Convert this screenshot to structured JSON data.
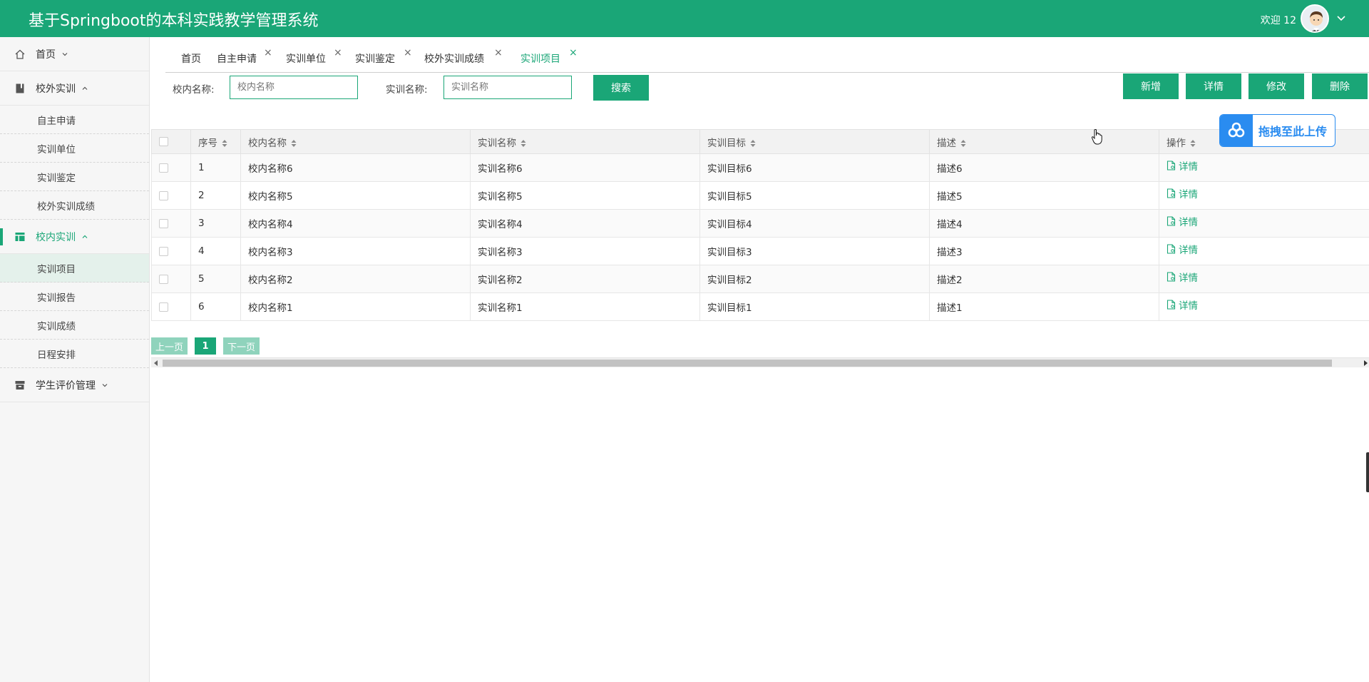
{
  "header": {
    "title": "基于Springboot的本科实践教学管理系统",
    "welcome": "欢迎 12"
  },
  "sidebar": {
    "home": "首页",
    "group_external": "校外实训",
    "external_items": [
      "自主申请",
      "实训单位",
      "实训鉴定",
      "校外实训成绩"
    ],
    "group_internal": "校内实训",
    "internal_items": [
      "实训项目",
      "实训报告",
      "实训成绩",
      "日程安排"
    ],
    "group_eval": "学生评价管理"
  },
  "tabs": [
    {
      "label": "首页",
      "closable": false
    },
    {
      "label": "自主申请",
      "closable": true
    },
    {
      "label": "实训单位",
      "closable": true
    },
    {
      "label": "实训鉴定",
      "closable": true
    },
    {
      "label": "校外实训成绩",
      "closable": true
    },
    {
      "label": "实训项目",
      "closable": true,
      "active": true
    }
  ],
  "tab_close_glyph": "×",
  "filters": {
    "school_name_label": "校内名称:",
    "school_name_placeholder": "校内名称",
    "training_name_label": "实训名称:",
    "training_name_placeholder": "实训名称",
    "search_button": "搜索"
  },
  "actions": {
    "add": "新增",
    "detail": "详情",
    "edit": "修改",
    "delete": "删除"
  },
  "upload_widget": {
    "label": "拖拽至此上传"
  },
  "table": {
    "columns": [
      "序号",
      "校内名称",
      "实训名称",
      "实训目标",
      "描述",
      "操作"
    ],
    "rows": [
      {
        "no": "1",
        "school": "校内名称6",
        "name": "实训名称6",
        "goal": "实训目标6",
        "desc": "描述6",
        "op": "详情"
      },
      {
        "no": "2",
        "school": "校内名称5",
        "name": "实训名称5",
        "goal": "实训目标5",
        "desc": "描述5",
        "op": "详情"
      },
      {
        "no": "3",
        "school": "校内名称4",
        "name": "实训名称4",
        "goal": "实训目标4",
        "desc": "描述4",
        "op": "详情"
      },
      {
        "no": "4",
        "school": "校内名称3",
        "name": "实训名称3",
        "goal": "实训目标3",
        "desc": "描述3",
        "op": "详情"
      },
      {
        "no": "5",
        "school": "校内名称2",
        "name": "实训名称2",
        "goal": "实训目标2",
        "desc": "描述2",
        "op": "详情"
      },
      {
        "no": "6",
        "school": "校内名称1",
        "name": "实训名称1",
        "goal": "实训目标1",
        "desc": "描述1",
        "op": "详情"
      }
    ]
  },
  "pagination": {
    "prev": "上一页",
    "current": "1",
    "next": "下一页"
  },
  "colors": {
    "primary": "#1aa677",
    "upload_blue": "#2a8cf0"
  }
}
